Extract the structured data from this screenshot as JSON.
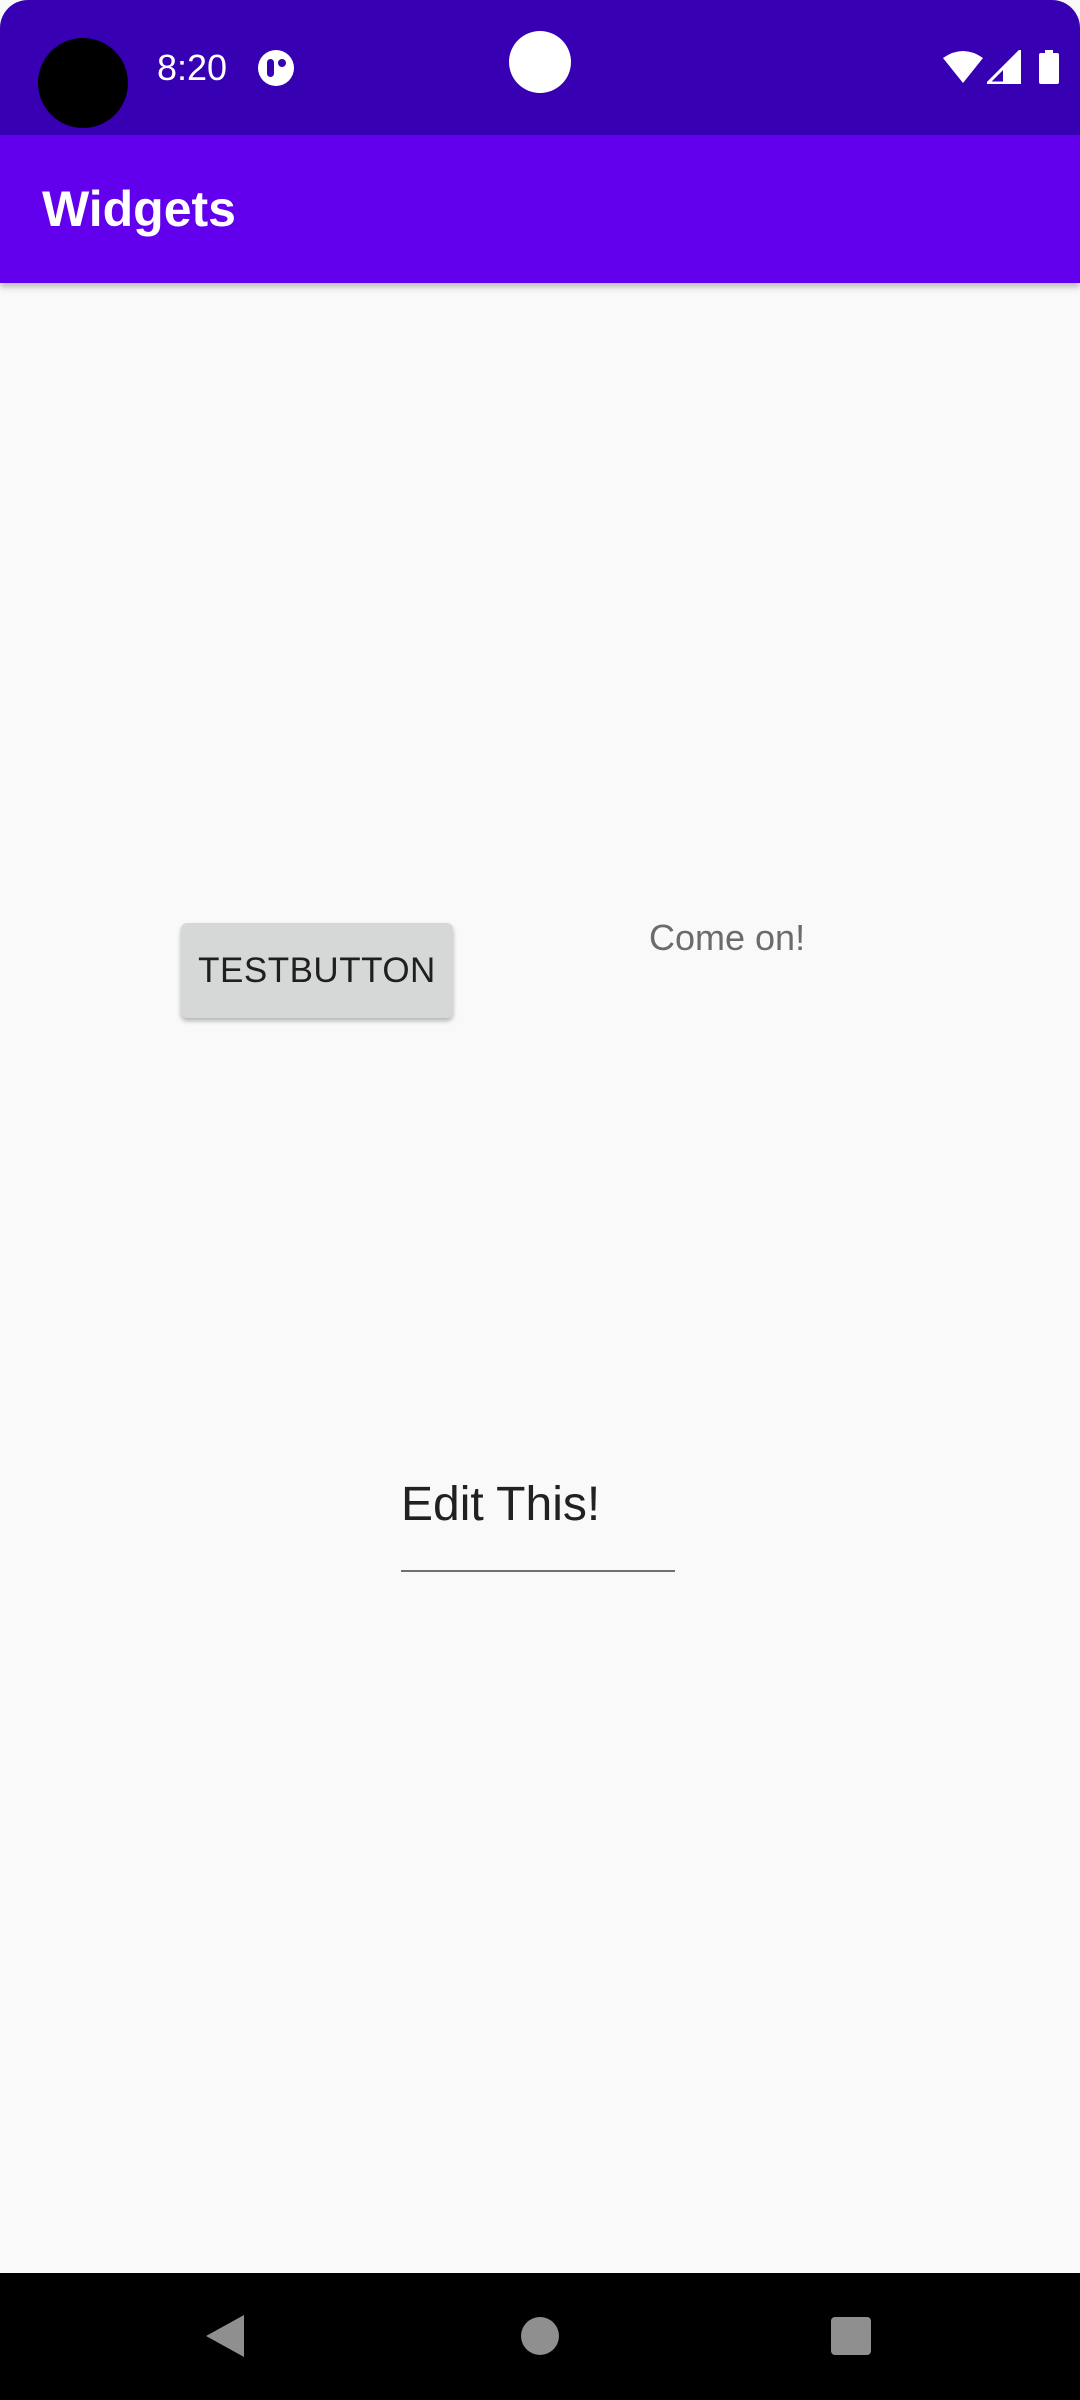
{
  "status_bar": {
    "time": "8:20",
    "background_color": "#3700b3",
    "icons": [
      "camera-cutout",
      "notification-icon",
      "wifi-icon",
      "cellular-signal-icon",
      "battery-icon"
    ]
  },
  "app_bar": {
    "title": "Widgets",
    "background_color": "#6200ee"
  },
  "content": {
    "button_label": "TESTBUTTON",
    "text_view": "Come on!",
    "edit_text_value": "Edit This!"
  },
  "nav_bar": {
    "buttons": [
      "back",
      "home",
      "recents"
    ]
  }
}
